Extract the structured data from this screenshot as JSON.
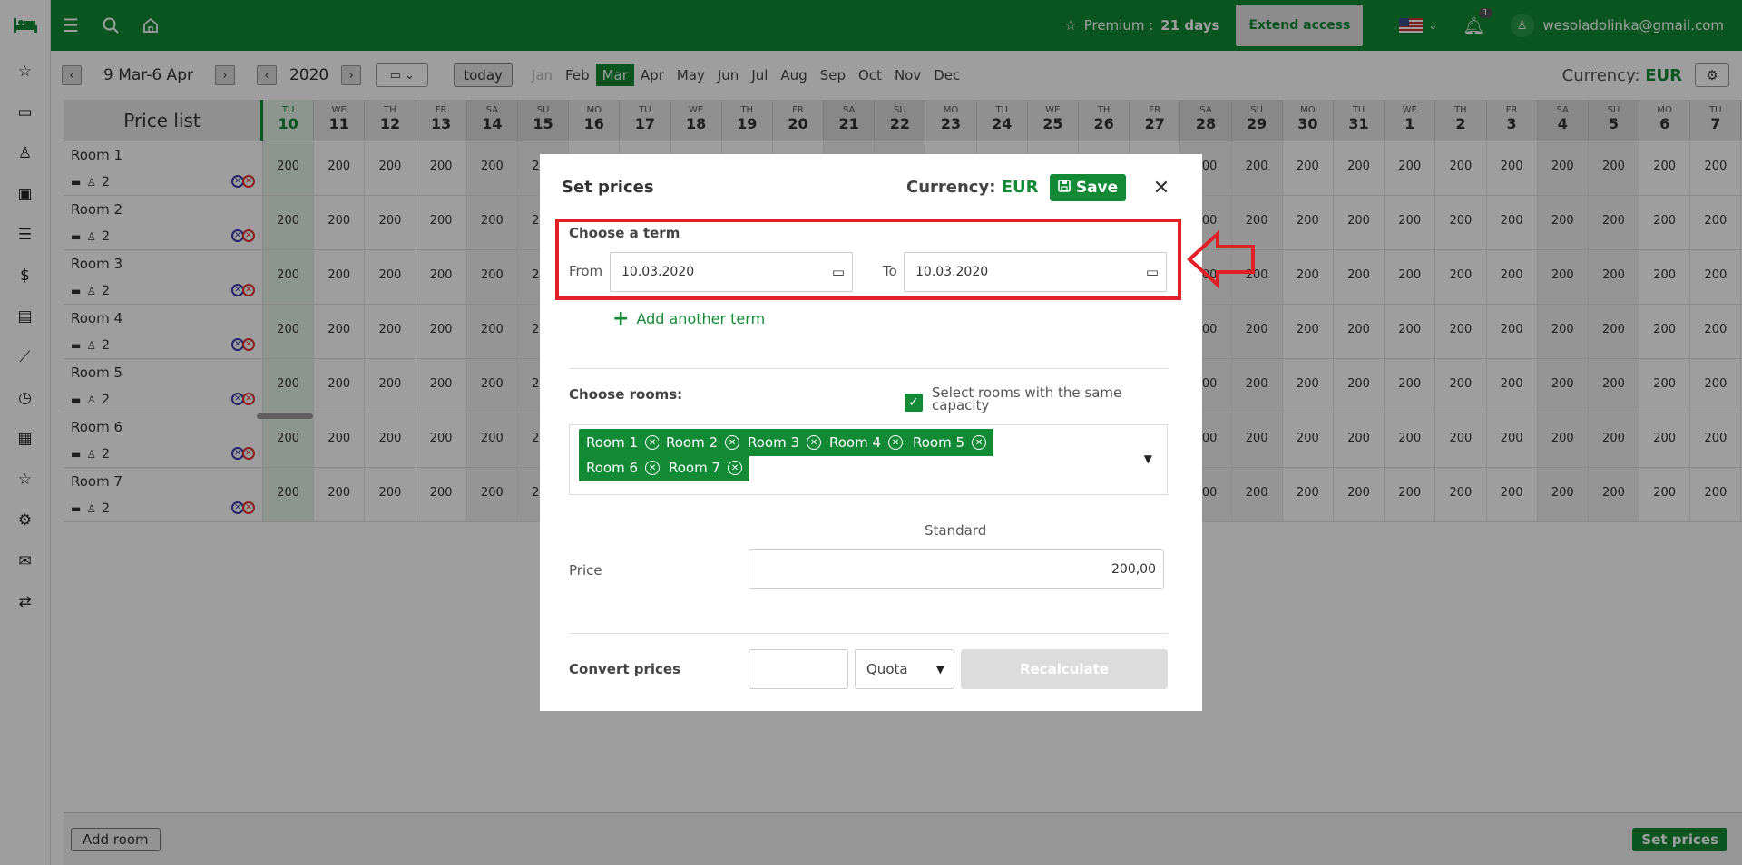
{
  "topbar": {
    "premium_label": "Premium : ",
    "premium_days": "21 days",
    "extend_label": "Extend access",
    "notif_count": "1",
    "user_email": "wesoladolinka@gmail.com"
  },
  "toolbar": {
    "range": "9 Mar-6 Apr",
    "year": "2020",
    "today_label": "today",
    "months": [
      "Jan",
      "Feb",
      "Mar",
      "Apr",
      "May",
      "Jun",
      "Jul",
      "Aug",
      "Sep",
      "Oct",
      "Nov",
      "Dec"
    ],
    "active_month": "Mar",
    "disabled_month": "Jan",
    "currency_prefix": "Currency:",
    "currency": "EUR"
  },
  "grid": {
    "title": "Price list",
    "days": [
      {
        "dow": "TU",
        "d": "10"
      },
      {
        "dow": "WE",
        "d": "11"
      },
      {
        "dow": "TH",
        "d": "12"
      },
      {
        "dow": "FR",
        "d": "13"
      },
      {
        "dow": "SA",
        "d": "14"
      },
      {
        "dow": "SU",
        "d": "15"
      },
      {
        "dow": "MO",
        "d": "16"
      },
      {
        "dow": "TU",
        "d": "17"
      },
      {
        "dow": "WE",
        "d": "18"
      },
      {
        "dow": "TH",
        "d": "19"
      },
      {
        "dow": "FR",
        "d": "20"
      },
      {
        "dow": "SA",
        "d": "21"
      },
      {
        "dow": "SU",
        "d": "22"
      },
      {
        "dow": "MO",
        "d": "23"
      },
      {
        "dow": "TU",
        "d": "24"
      },
      {
        "dow": "WE",
        "d": "25"
      },
      {
        "dow": "TH",
        "d": "26"
      },
      {
        "dow": "FR",
        "d": "27"
      },
      {
        "dow": "SA",
        "d": "28"
      },
      {
        "dow": "SU",
        "d": "29"
      },
      {
        "dow": "MO",
        "d": "30"
      },
      {
        "dow": "TU",
        "d": "31"
      },
      {
        "dow": "WE",
        "d": "1"
      },
      {
        "dow": "TH",
        "d": "2"
      },
      {
        "dow": "FR",
        "d": "3"
      },
      {
        "dow": "SA",
        "d": "4"
      },
      {
        "dow": "SU",
        "d": "5"
      },
      {
        "dow": "MO",
        "d": "6"
      },
      {
        "dow": "TU",
        "d": "7"
      }
    ],
    "rooms": [
      {
        "name": "Room 1",
        "capacity": "2"
      },
      {
        "name": "Room 2",
        "capacity": "2"
      },
      {
        "name": "Room 3",
        "capacity": "2"
      },
      {
        "name": "Room 4",
        "capacity": "2"
      },
      {
        "name": "Room 5",
        "capacity": "2"
      },
      {
        "name": "Room 6",
        "capacity": "2"
      },
      {
        "name": "Room 7",
        "capacity": "2"
      }
    ],
    "price": "200"
  },
  "bottombar": {
    "add_room": "Add room",
    "set_prices": "Set prices"
  },
  "modal": {
    "title": "Set prices",
    "currency_prefix": "Currency:",
    "currency": "EUR",
    "save_label": "Save",
    "term_title": "Choose a term",
    "from_label": "From",
    "from_value": "10.03.2020",
    "to_label": "To",
    "to_value": "10.03.2020",
    "add_term": "Add another term",
    "rooms_title": "Choose rooms:",
    "same_capacity": "Select rooms with the same capacity",
    "selected_rooms": [
      "Room 1",
      "Room 2",
      "Room 3",
      "Room 4",
      "Room 5",
      "Room 6",
      "Room 7"
    ],
    "standard_label": "Standard",
    "price_label": "Price",
    "price_value": "200,00",
    "convert_label": "Convert prices",
    "quota_value": "Quota",
    "recalc_label": "Recalculate"
  },
  "colors": {
    "brand": "#138a36",
    "highlight": "#e01f26"
  }
}
